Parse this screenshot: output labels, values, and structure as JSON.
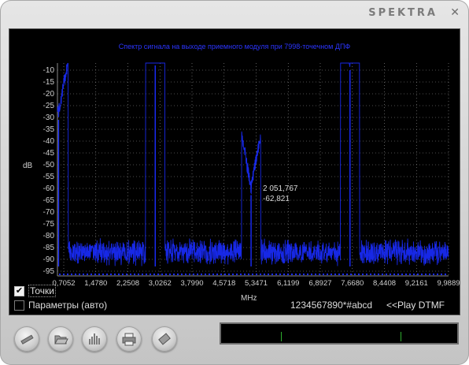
{
  "app": {
    "title": "SPEKTRA",
    "close_glyph": "✕"
  },
  "plot": {
    "title": "Спектр сигнала на выходе приемного модуля при 7998-точечном ДПФ",
    "ylabel": "dB",
    "xlabel": "MHz",
    "marker": {
      "freq_label": "2 051,767",
      "level_label": "-62,821"
    }
  },
  "controls": {
    "points_label": "Точки",
    "points_checked": true,
    "params_label": "Параметры (авто)",
    "params_checked": false,
    "dtmf_input": "1234567890*#abcd",
    "play_dtmf": "<<Play DTMF"
  },
  "toolbar": {
    "buttons": [
      {
        "name": "pencil-icon"
      },
      {
        "name": "folder-open-icon"
      },
      {
        "name": "bar-graph-icon"
      },
      {
        "name": "printer-icon"
      },
      {
        "name": "eraser-icon"
      }
    ]
  },
  "colors": {
    "trace": "#1a2cff",
    "grid": "#9a9a9a",
    "axis_text": "#d0d0d0",
    "panel": "#000000",
    "meter_tick": "#2fae2f"
  },
  "chart_data": {
    "type": "line",
    "title": "Спектр сигнала на выходе приемного модуля при 7998-точечном ДПФ",
    "xlabel": "MHz",
    "ylabel": "dB",
    "x_ticks": [
      "0,7052",
      "1,4780",
      "2,2508",
      "3,0262",
      "3,7990",
      "4,5718",
      "5,3471",
      "6,1199",
      "6,8927",
      "7,6680",
      "8,4408",
      "9,2161",
      "9,9889"
    ],
    "y_ticks": [
      -10,
      -15,
      -20,
      -25,
      -30,
      -35,
      -40,
      -45,
      -50,
      -55,
      -60,
      -65,
      -70,
      -75,
      -80,
      -85,
      -90,
      -95
    ],
    "xlim": [
      0,
      10.2
    ],
    "ylim": [
      -97,
      -7
    ],
    "noise_floor_db": -85,
    "peaks": [
      {
        "x": 0.03,
        "y": -31
      },
      {
        "x": 2.55,
        "y": -8
      },
      {
        "x": 5.05,
        "y": -62.821
      },
      {
        "x": 7.63,
        "y": -10
      }
    ],
    "grid": true
  }
}
